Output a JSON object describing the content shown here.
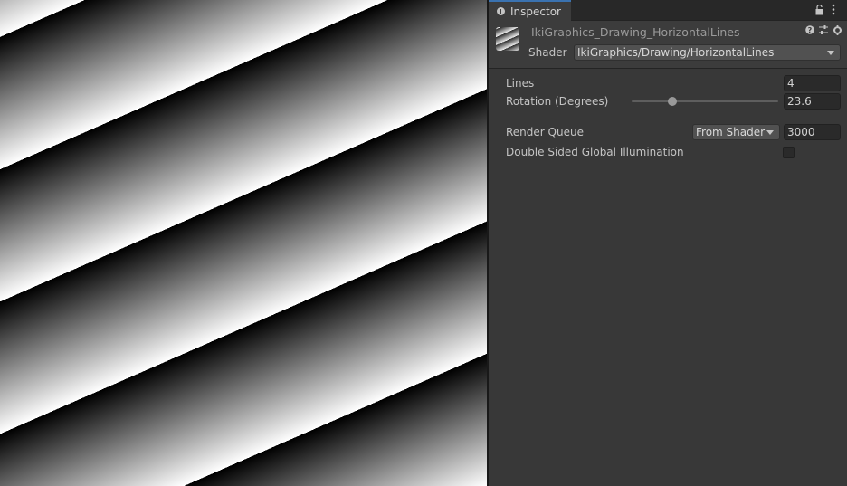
{
  "inspector": {
    "tab_label": "Inspector",
    "material_name": "IkiGraphics_Drawing_HorizontalLines",
    "shader_label": "Shader",
    "shader_value": "IkiGraphics/Drawing/HorizontalLines"
  },
  "properties": {
    "lines_label": "Lines",
    "lines_value": "4",
    "rotation_label": "Rotation (Degrees)",
    "rotation_value": "23.6",
    "render_queue_label": "Render Queue",
    "render_queue_mode": "From Shader",
    "render_queue_value": "3000",
    "double_sided_gi_label": "Double Sided Global Illumination",
    "double_sided_gi_checked": false
  },
  "icons": [
    "info-icon",
    "lock-icon",
    "kebab-menu-icon",
    "material-preview-icon",
    "help-icon",
    "preset-icon",
    "gear-icon",
    "dropdown-arrow-icon"
  ]
}
